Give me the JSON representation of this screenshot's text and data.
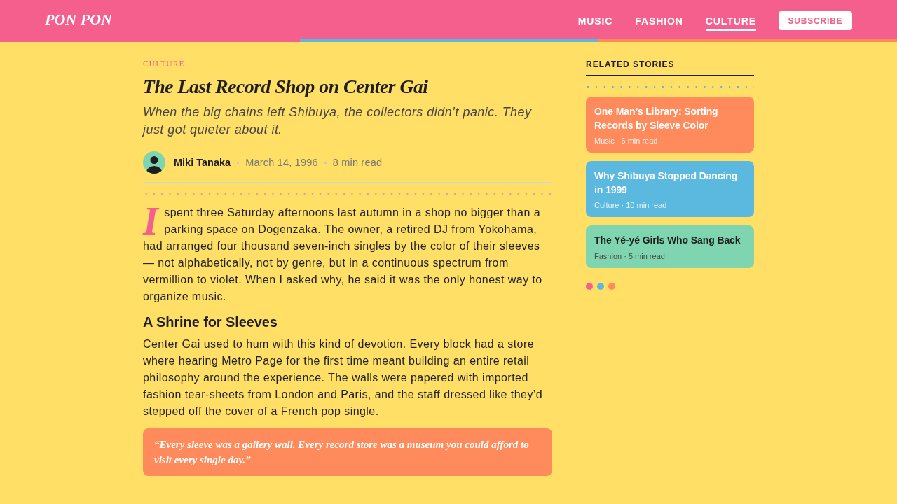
{
  "header": {
    "logo": "PON PON",
    "nav": [
      {
        "label": "MUSIC",
        "selected": false
      },
      {
        "label": "FASHION",
        "selected": false
      },
      {
        "label": "CULTURE",
        "selected": true
      }
    ],
    "subscribe_button": "SUBSCRIBE"
  },
  "article": {
    "category": "CULTURE",
    "title": "The Last Record Shop on Center Gai",
    "subtitle": "When the big chains left Shibuya, the collectors didn’t panic. They just got quieter about it.",
    "byline": {
      "author": "Miki Tanaka",
      "date": "March 14, 1996",
      "read_time": "8 min read"
    },
    "body": [
      {
        "kind": "paragraph",
        "drop_cap": true,
        "text": "I spent three Saturday afternoons last autumn in a shop no bigger than a parking space on Dogenzaka. The owner, a retired DJ from Yokohama, had arranged four thousand seven-inch singles by the color of their sleeves — not alphabetically, not by genre, but in a continuous spectrum from vermillion to violet. When I asked why, he said it was the only honest way to organize music."
      },
      {
        "kind": "heading",
        "text": "A Shrine for Sleeves"
      },
      {
        "kind": "paragraph",
        "drop_cap": false,
        "text": "Center Gai used to hum with this kind of devotion. Every block had a store where hearing Metro Page for the first time meant building an entire retail philosophy around the experience. The walls were papered with imported fashion tear-sheets from London and Paris, and the staff dressed like they’d stepped off the cover of a French pop single."
      },
      {
        "kind": "pullquote",
        "text": "“Every sleeve was a gallery wall. Every record store was a museum you could afford to visit every single day.”"
      }
    ]
  },
  "sidebar": {
    "heading": "RELATED STORIES",
    "stories": [
      {
        "title": "One Man’s Library: Sorting Records by Sleeve Color",
        "meta": "Music · 6 min read",
        "color": "#ff8a5b"
      },
      {
        "title": "Why Shibuya Stopped Dancing in 1999",
        "meta": "Culture · 10 min read",
        "color": "#5bb8de"
      },
      {
        "title": "The Yé-yé Girls Who Sang Back",
        "meta": "Fashion · 5 min read",
        "color": "#7ed5af"
      }
    ]
  }
}
